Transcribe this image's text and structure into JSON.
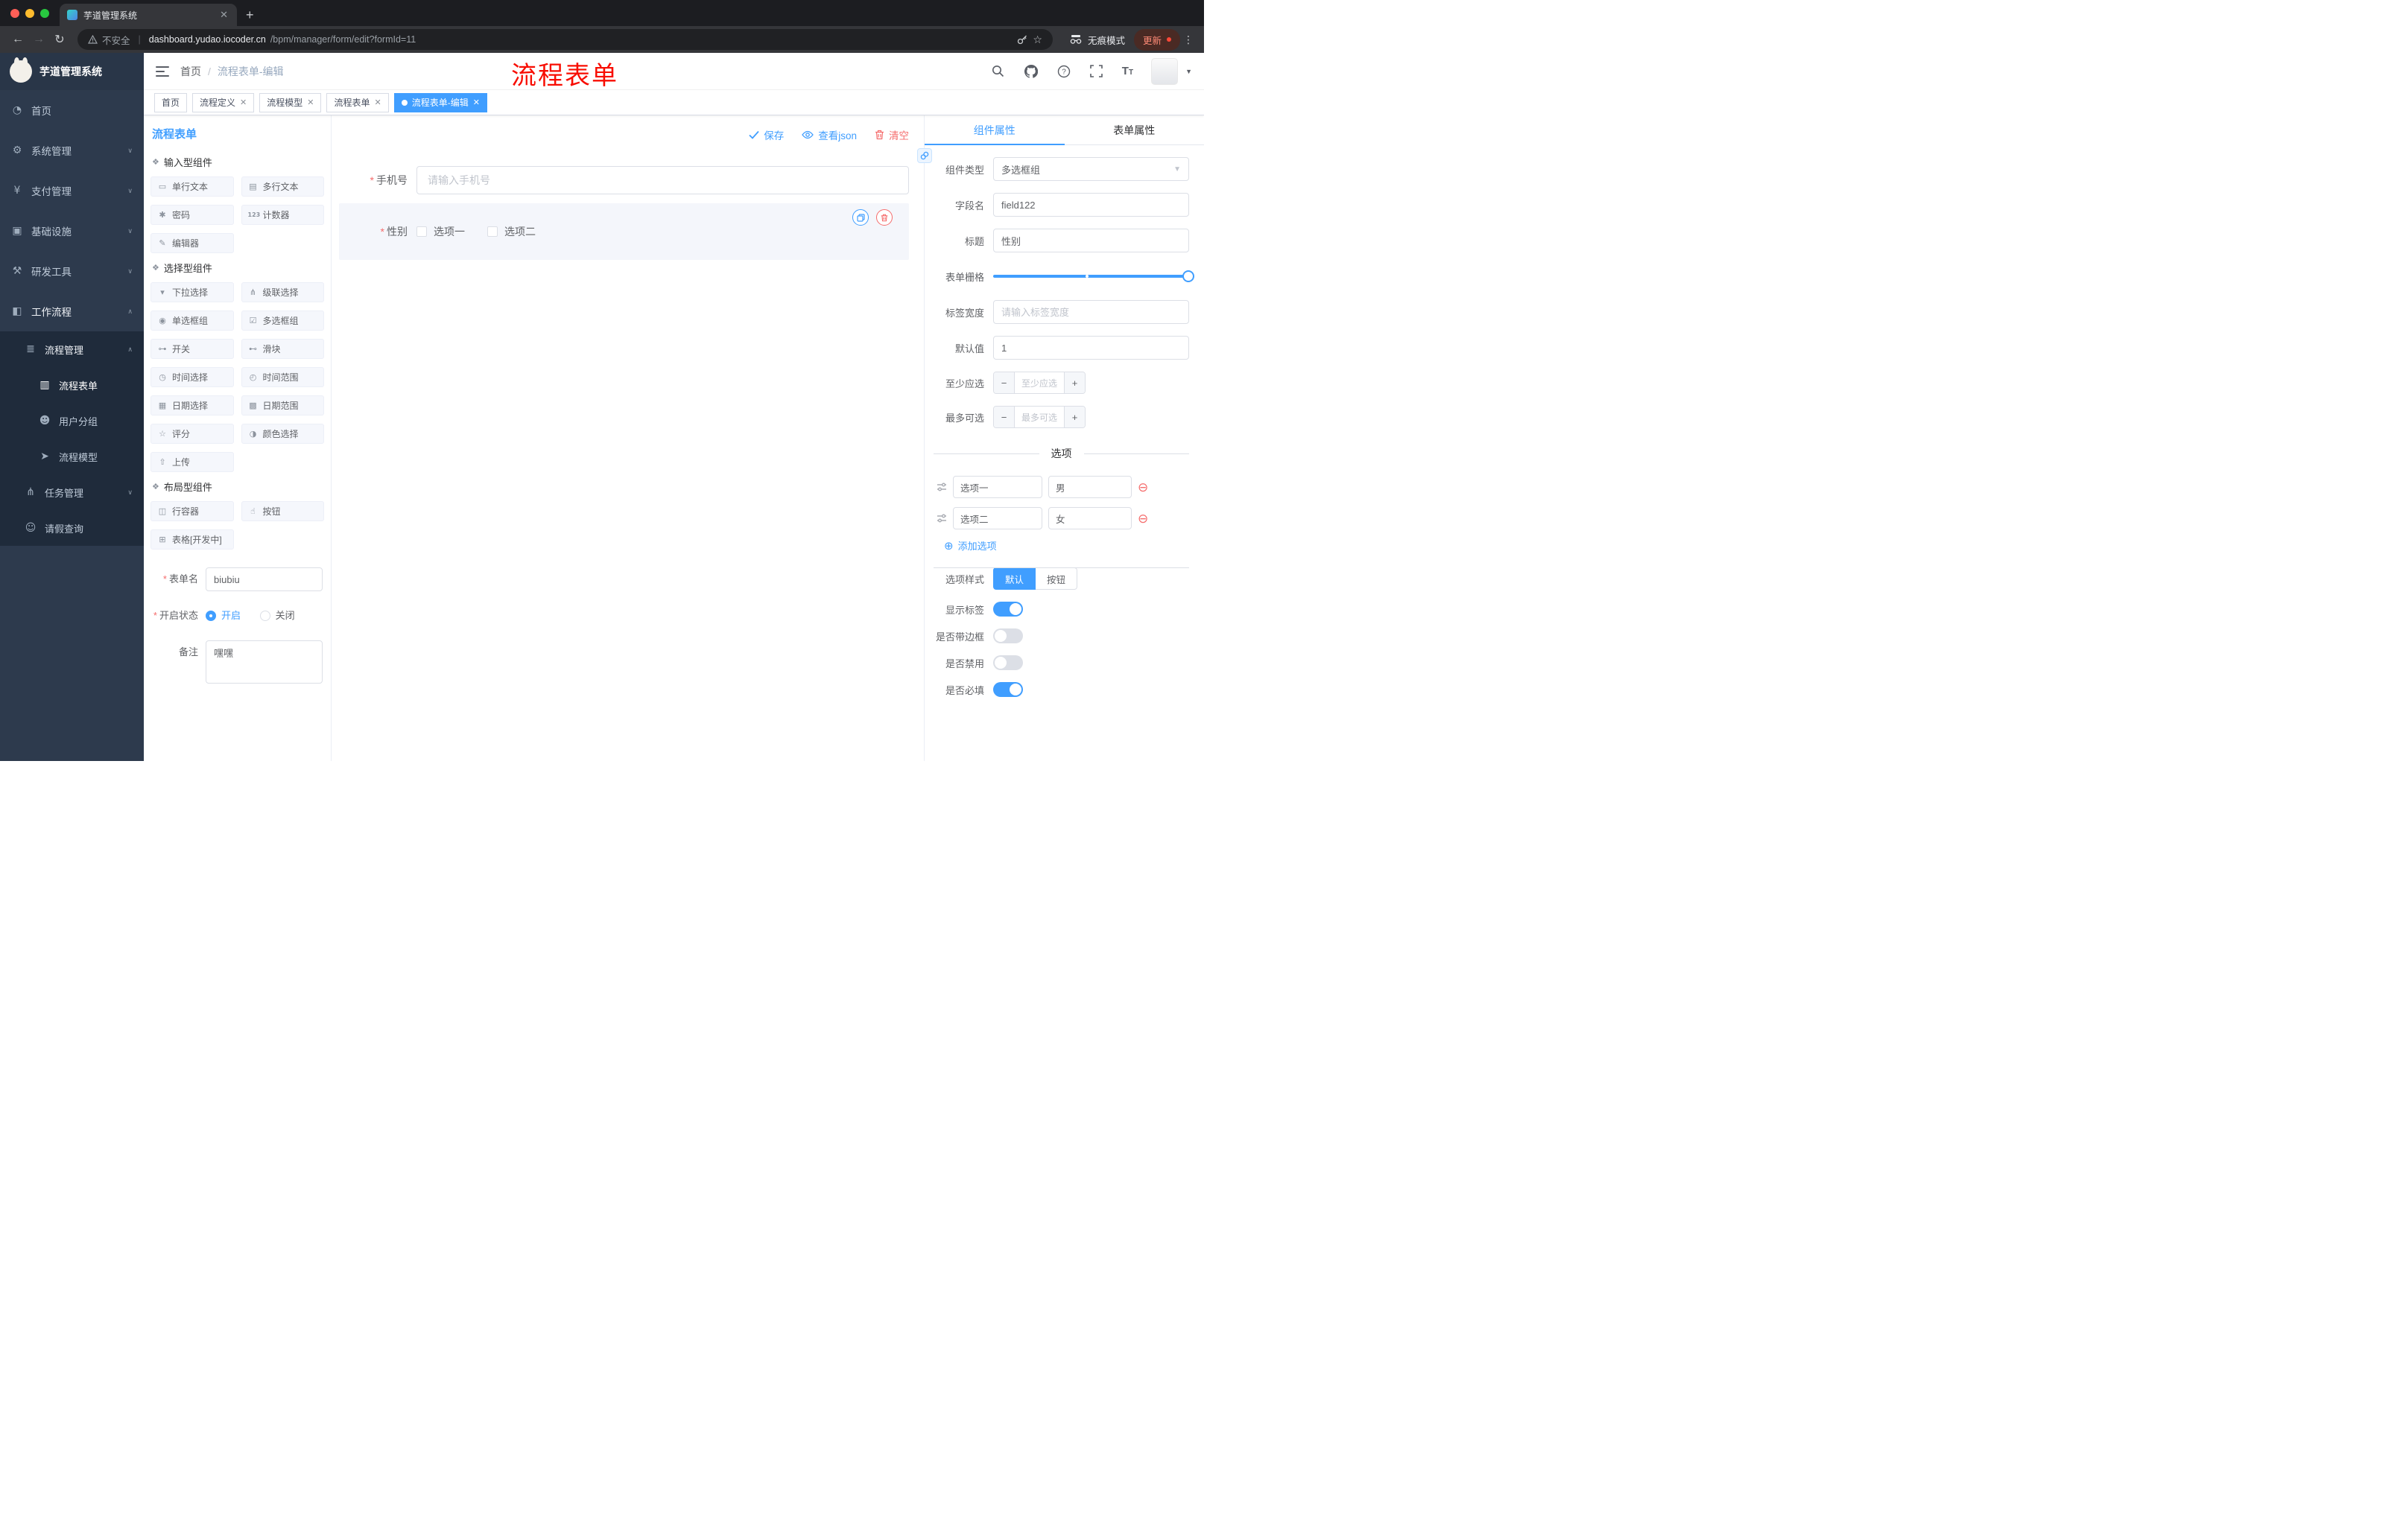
{
  "annotation": {
    "text": "流程表单"
  },
  "browser": {
    "tab_title": "芋道管理系统",
    "security": "不安全",
    "url_host": "dashboard.yudao.iocoder.cn",
    "url_path": "/bpm/manager/form/edit?formId=11",
    "incognito": "无痕模式",
    "update": "更新"
  },
  "sidebar": {
    "logo_title": "芋道管理系统",
    "menu": [
      {
        "label": "首页",
        "icon": "dashboard-icon"
      },
      {
        "label": "系统管理",
        "icon": "gear-icon"
      },
      {
        "label": "支付管理",
        "icon": "payment-icon"
      },
      {
        "label": "基础设施",
        "icon": "infrastructure-icon"
      },
      {
        "label": "研发工具",
        "icon": "devtools-icon"
      },
      {
        "label": "工作流程",
        "icon": "workflow-icon"
      },
      {
        "label": "流程管理",
        "icon": "process-management-icon"
      },
      {
        "label": "流程表单",
        "icon": "form-icon",
        "active": true
      },
      {
        "label": "用户分组",
        "icon": "user-group-icon"
      },
      {
        "label": "流程模型",
        "icon": "model-icon"
      },
      {
        "label": "任务管理",
        "icon": "task-icon"
      },
      {
        "label": "请假查询",
        "icon": "leave-icon"
      }
    ]
  },
  "header": {
    "breadcrumb_home": "首页",
    "breadcrumb_separator": "/",
    "breadcrumb_current": "流程表单-编辑"
  },
  "tags": [
    {
      "label": "首页",
      "closable": false,
      "active": false
    },
    {
      "label": "流程定义",
      "closable": true,
      "active": false
    },
    {
      "label": "流程模型",
      "closable": true,
      "active": false
    },
    {
      "label": "流程表单",
      "closable": true,
      "active": false
    },
    {
      "label": "流程表单-编辑",
      "closable": true,
      "active": true
    }
  ],
  "palette": {
    "title": "流程表单",
    "sections": [
      {
        "title": "输入型组件",
        "items": [
          {
            "label": "单行文本",
            "icon": "text-input-icon"
          },
          {
            "label": "多行文本",
            "icon": "textarea-icon"
          },
          {
            "label": "密码",
            "icon": "password-icon"
          },
          {
            "label": "计数器",
            "icon": "counter-icon"
          },
          {
            "label": "编辑器",
            "icon": "editor-icon"
          }
        ]
      },
      {
        "title": "选择型组件",
        "items": [
          {
            "label": "下拉选择",
            "icon": "select-icon"
          },
          {
            "label": "级联选择",
            "icon": "cascader-icon"
          },
          {
            "label": "单选框组",
            "icon": "radio-group-icon"
          },
          {
            "label": "多选框组",
            "icon": "checkbox-group-icon"
          },
          {
            "label": "开关",
            "icon": "switch-icon"
          },
          {
            "label": "滑块",
            "icon": "slider-icon"
          },
          {
            "label": "时间选择",
            "icon": "time-picker-icon"
          },
          {
            "label": "时间范围",
            "icon": "time-range-icon"
          },
          {
            "label": "日期选择",
            "icon": "date-picker-icon"
          },
          {
            "label": "日期范围",
            "icon": "date-range-icon"
          },
          {
            "label": "评分",
            "icon": "rate-icon"
          },
          {
            "label": "颜色选择",
            "icon": "color-picker-icon"
          },
          {
            "label": "上传",
            "icon": "upload-icon"
          }
        ]
      },
      {
        "title": "布局型组件",
        "items": [
          {
            "label": "行容器",
            "icon": "row-container-icon"
          },
          {
            "label": "按钮",
            "icon": "button-icon"
          },
          {
            "label": "表格[开发中]",
            "icon": "table-icon"
          }
        ]
      }
    ],
    "form": {
      "name_label": "表单名",
      "name_value": "biubiu",
      "status_label": "开启状态",
      "status_on": "开启",
      "status_off": "关闭",
      "status_selected": "开启",
      "remark_label": "备注",
      "remark_value": "嘿嘿"
    }
  },
  "canvas": {
    "save": "保存",
    "view_json": "查看json",
    "clear": "清空",
    "phone": {
      "label": "手机号",
      "required": true,
      "placeholder": "请输入手机号"
    },
    "gender": {
      "label": "性别",
      "required": true,
      "option1": "选项一",
      "option2": "选项二"
    }
  },
  "props": {
    "tab_component": "组件属性",
    "tab_form": "表单属性",
    "active_tab": "组件属性",
    "component_type": {
      "label": "组件类型",
      "value": "多选框组"
    },
    "field_name": {
      "label": "字段名",
      "value": "field122"
    },
    "title": {
      "label": "标题",
      "value": "性别"
    },
    "grid": {
      "label": "表单栅格"
    },
    "label_width": {
      "label": "标签宽度",
      "placeholder": "请输入标签宽度"
    },
    "default_value": {
      "label": "默认值",
      "value": "1"
    },
    "min_select": {
      "label": "至少应选",
      "placeholder": "至少应选"
    },
    "max_select": {
      "label": "最多可选",
      "placeholder": "最多可选"
    },
    "options_title": "选项",
    "options": [
      {
        "name": "选项一",
        "value": "男"
      },
      {
        "name": "选项二",
        "value": "女"
      }
    ],
    "add_option": "添加选项",
    "option_style": {
      "label": "选项样式",
      "default": "默认",
      "button": "按钮",
      "selected": "默认"
    },
    "toggles": [
      {
        "label": "显示标签",
        "on": true
      },
      {
        "label": "是否带边框",
        "on": false
      },
      {
        "label": "是否禁用",
        "on": false
      },
      {
        "label": "是否必填",
        "on": true
      }
    ]
  },
  "colors": {
    "accent": "#409eff",
    "danger": "#f56c6c",
    "annotation": "#f80d02",
    "active_tag_bg": "#409eff"
  }
}
